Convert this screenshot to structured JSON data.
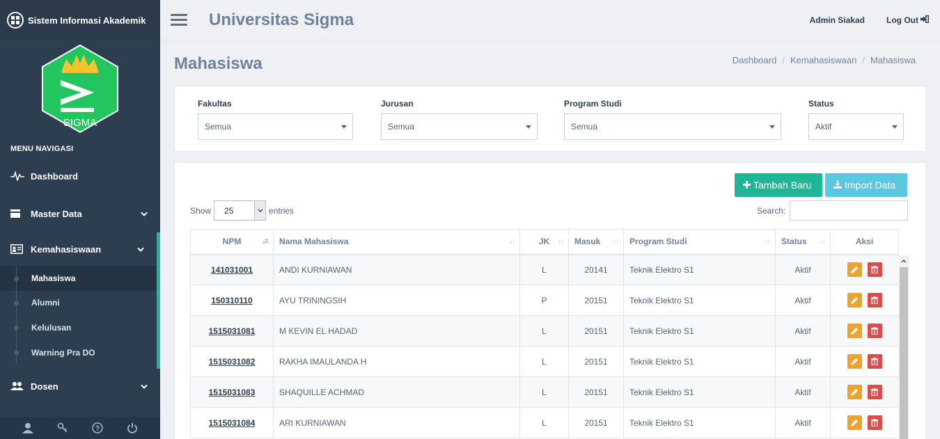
{
  "brand": {
    "title": "Sistem Informasi Akademik",
    "logo_text": "SIGMA"
  },
  "topbar": {
    "university": "Universitas Sigma",
    "user": "Admin Siakad",
    "logout": "Log Out"
  },
  "sidebar": {
    "menu_header": "MENU NAVIGASI",
    "items": [
      {
        "label": "Dashboard"
      },
      {
        "label": "Master Data"
      },
      {
        "label": "Kemahasiswaan"
      },
      {
        "label": "Dosen"
      }
    ],
    "subitems": [
      {
        "label": "Mahasiswa"
      },
      {
        "label": "Alumni"
      },
      {
        "label": "Kelulusan"
      },
      {
        "label": "Warning Pra DO"
      }
    ]
  },
  "page": {
    "title": "Mahasiswa",
    "breadcrumb": [
      "Dashboard",
      "Kemahasiswaan",
      "Mahasiswa"
    ]
  },
  "filters": {
    "fakultas": {
      "label": "Fakultas",
      "value": "Semua"
    },
    "jurusan": {
      "label": "Jurusan",
      "value": "Semua"
    },
    "prodi": {
      "label": "Program Studi",
      "value": "Semua"
    },
    "status": {
      "label": "Status",
      "value": "Aktif"
    }
  },
  "actions": {
    "add": "Tambah Baru",
    "import": "Import Data"
  },
  "table": {
    "show_label": "Show",
    "entries_value": "25",
    "entries_label": "entries",
    "search_label": "Search:",
    "headers": [
      "NPM",
      "Nama Mahasiswa",
      "JK",
      "Masuk",
      "Program Studi",
      "Status",
      "Aksi"
    ],
    "rows": [
      {
        "npm": "141031001",
        "nama": "ANDI KURNIAWAN",
        "jk": "L",
        "masuk": "20141",
        "prodi": "Teknik Elektro S1",
        "status": "Aktif"
      },
      {
        "npm": "150310110",
        "nama": "AYU TRININGSIH",
        "jk": "P",
        "masuk": "20151",
        "prodi": "Teknik Elektro S1",
        "status": "Aktif"
      },
      {
        "npm": "1515031081",
        "nama": "M KEVIN EL HADAD",
        "jk": "L",
        "masuk": "20151",
        "prodi": "Teknik Elektro S1",
        "status": "Aktif"
      },
      {
        "npm": "1515031082",
        "nama": "RAKHA IMAULANDA H",
        "jk": "L",
        "masuk": "20151",
        "prodi": "Teknik Elektro S1",
        "status": "Aktif"
      },
      {
        "npm": "1515031083",
        "nama": "SHAQUILLE ACHMAD",
        "jk": "L",
        "masuk": "20151",
        "prodi": "Teknik Elektro S1",
        "status": "Aktif"
      },
      {
        "npm": "1515031084",
        "nama": "ARI KURNIAWAN",
        "jk": "L",
        "masuk": "20151",
        "prodi": "Teknik Elektro S1",
        "status": "Aktif"
      }
    ]
  },
  "colors": {
    "sidebar": "#2d3e50",
    "accent": "#1abc9c",
    "add_button": "#1fb596",
    "import_button": "#5bc8e1",
    "edit": "#f0a22e",
    "delete": "#dd4b4b",
    "logo": "#22c55e"
  }
}
